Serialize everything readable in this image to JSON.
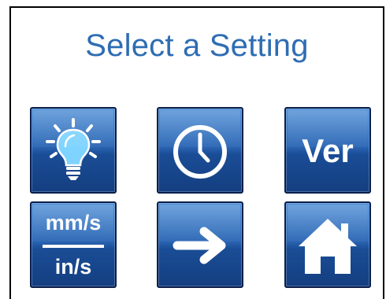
{
  "screen": {
    "title": "Select a Setting"
  },
  "tiles": {
    "brightness": {
      "icon": "lightbulb-icon"
    },
    "clock": {
      "icon": "clock-icon"
    },
    "version": {
      "label": "Ver"
    },
    "units": {
      "top_label": "mm/s",
      "bottom_label": "in/s"
    },
    "next": {
      "icon": "arrow-right-icon"
    },
    "home": {
      "icon": "home-icon"
    }
  },
  "colors": {
    "title": "#2e6db3",
    "tile_top": "#4f8fd6",
    "tile_bottom": "#143e80",
    "bulb": "#7fd3ff"
  }
}
